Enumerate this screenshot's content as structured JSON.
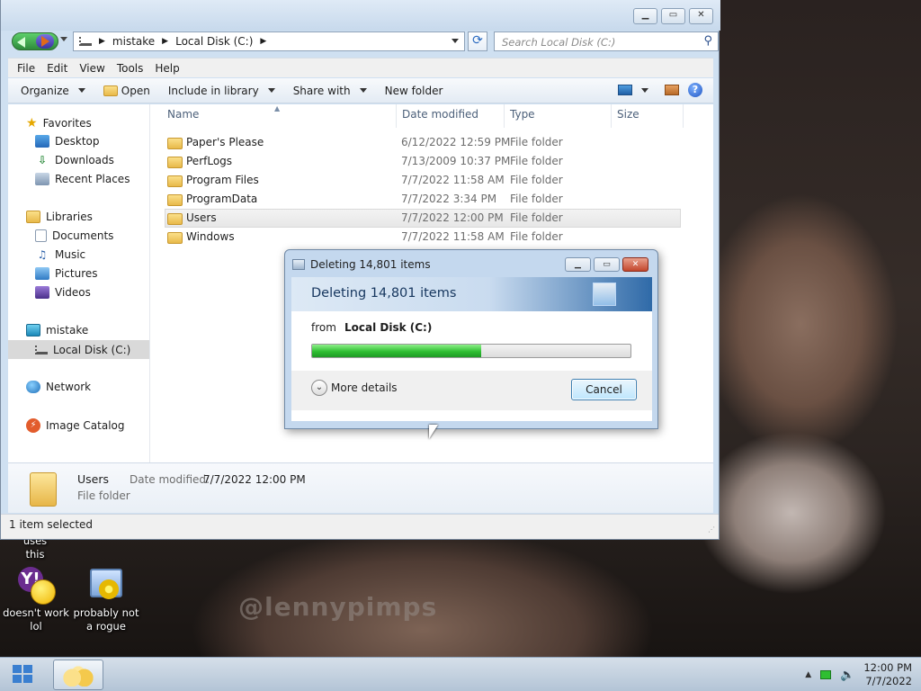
{
  "explorer": {
    "path": [
      "mistake",
      "Local Disk (C:)"
    ],
    "search_placeholder": "Search Local Disk (C:)",
    "menu": [
      "File",
      "Edit",
      "View",
      "Tools",
      "Help"
    ],
    "toolbar": {
      "organize": "Organize",
      "open": "Open",
      "include": "Include in library",
      "share": "Share with",
      "new_folder": "New folder"
    },
    "nav": {
      "favorites": "Favorites",
      "desktop": "Desktop",
      "downloads": "Downloads",
      "recent": "Recent Places",
      "libraries": "Libraries",
      "documents": "Documents",
      "music": "Music",
      "pictures": "Pictures",
      "videos": "Videos",
      "computer": "mistake",
      "local_disk": "Local Disk (C:)",
      "network": "Network",
      "image_catalog": "Image Catalog"
    },
    "columns": {
      "name": "Name",
      "date": "Date modified",
      "type": "Type",
      "size": "Size"
    },
    "rows": [
      {
        "name": "Paper's Please",
        "date": "6/12/2022 12:59 PM",
        "type": "File folder"
      },
      {
        "name": "PerfLogs",
        "date": "7/13/2009 10:37 PM",
        "type": "File folder"
      },
      {
        "name": "Program Files",
        "date": "7/7/2022 11:58 AM",
        "type": "File folder"
      },
      {
        "name": "ProgramData",
        "date": "7/7/2022 3:34 PM",
        "type": "File folder"
      },
      {
        "name": "Users",
        "date": "7/7/2022 12:00 PM",
        "type": "File folder"
      },
      {
        "name": "Windows",
        "date": "7/7/2022 11:58 AM",
        "type": "File folder"
      }
    ],
    "details": {
      "name": "Users",
      "date_label": "Date modified:",
      "date": "7/7/2022 12:00 PM",
      "type": "File folder"
    },
    "status": "1 item selected"
  },
  "dialog": {
    "title": "Deleting 14,801 items",
    "heading": "Deleting 14,801 items",
    "from_label": "from",
    "from_value": "Local Disk (C:)",
    "progress": 0.53,
    "more_details": "More details",
    "cancel": "Cancel"
  },
  "desktop": {
    "cut_label": "uses this",
    "icon1": "doesn't work lol",
    "icon2": "probably not a rogue",
    "watermark": "@lennypimps"
  },
  "taskbar": {
    "time": "12:00 PM",
    "date": "7/7/2022"
  }
}
